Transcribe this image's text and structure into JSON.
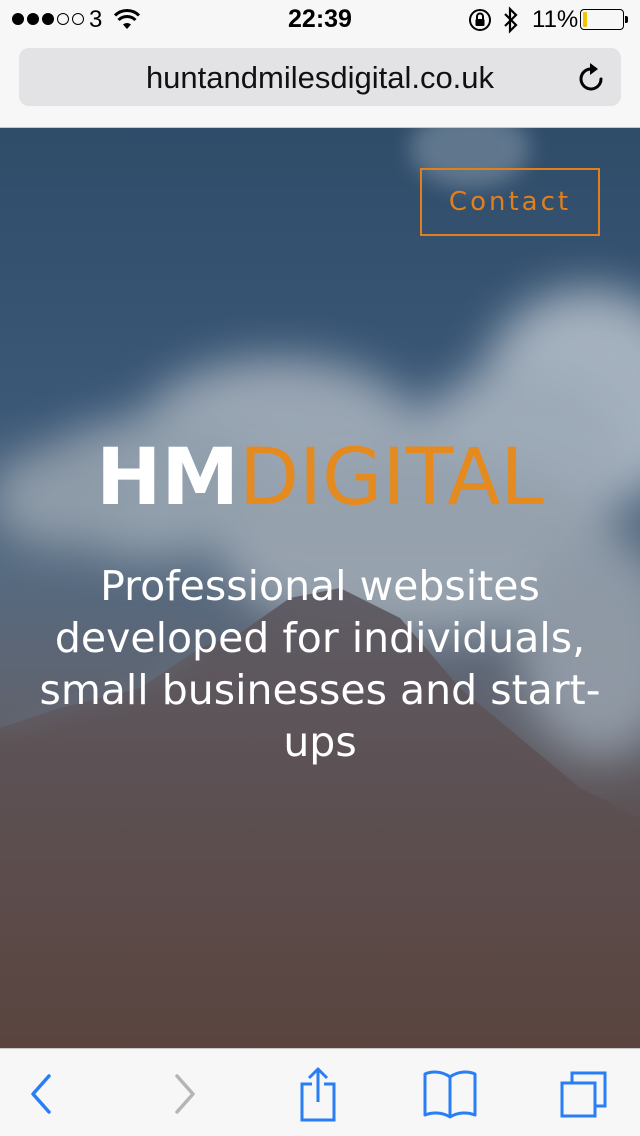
{
  "status_bar": {
    "carrier": "3",
    "time": "22:39",
    "battery_percent": "11%",
    "battery_level": 0.11,
    "signal_bars_filled": 3,
    "signal_bars_total": 5
  },
  "browser": {
    "url": "huntandmilesdigital.co.uk"
  },
  "page": {
    "contact_label": "Contact",
    "logo_bold": "HM",
    "logo_light": "DIGITAL",
    "tagline": "Professional websites developed for individuals, small businesses and start-ups"
  },
  "colors": {
    "accent": "#e07f1e",
    "toolbar_blue": "#2a7ef5",
    "toolbar_disabled": "#b5b5b8"
  },
  "toolbar": {
    "icons": [
      "back-icon",
      "forward-icon",
      "share-icon",
      "bookmarks-icon",
      "tabs-icon"
    ]
  }
}
